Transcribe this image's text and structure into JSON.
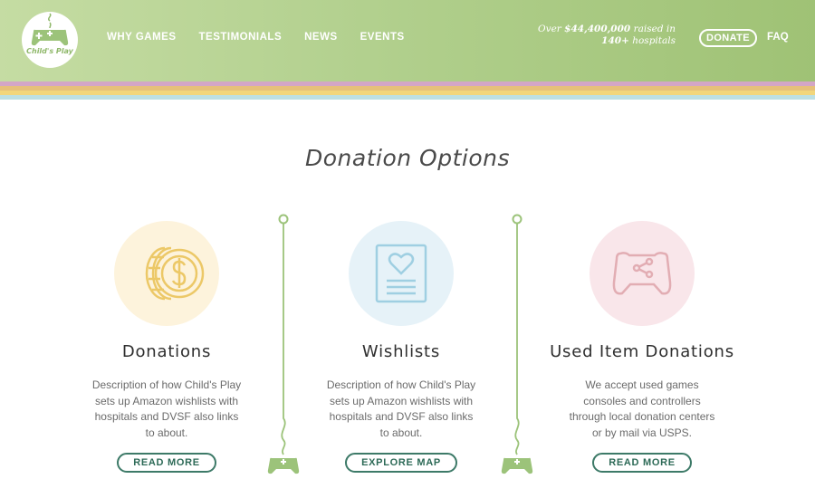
{
  "brand": {
    "logo_text": "Child's Play",
    "accent": "#a5c77e"
  },
  "nav": {
    "items": [
      "WHY GAMES",
      "TESTIMONIALS",
      "NEWS",
      "EVENTS"
    ]
  },
  "header": {
    "raised_prefix": "Over",
    "raised_amount": "$44,400,000",
    "raised_suffix": "raised in",
    "hospitals_count": "140+",
    "hospitals_label": "hospitals",
    "donate_label": "DONATE",
    "faq_label": "FAQ"
  },
  "stripes": [
    "#d3a6c6",
    "#e6c07a",
    "#f2d67c",
    "#bde0e4"
  ],
  "main": {
    "title": "Donation Options",
    "options": [
      {
        "icon": "coins-icon",
        "circle_color": "#fdf3dc",
        "icon_color": "#ecc867",
        "title": "Donations",
        "description": "Description of how Child's Play sets up Amazon wishlists with hospitals and DVSF also links to about.",
        "button": "READ MORE"
      },
      {
        "icon": "wishlist-heart-icon",
        "circle_color": "#e6f2f8",
        "icon_color": "#9fcfe2",
        "title": "Wishlists",
        "description": "Description of how Child's Play sets up Amazon wishlists with hospitals and DVSF also links to about.",
        "button": "EXPLORE MAP"
      },
      {
        "icon": "gamepad-share-icon",
        "circle_color": "#f9e6ea",
        "icon_color": "#e2adb3",
        "title": "Used Item Donations",
        "description": "We accept used games consoles and controllers through local donation centers or by mail via USPS.",
        "button": "READ MORE"
      }
    ]
  }
}
